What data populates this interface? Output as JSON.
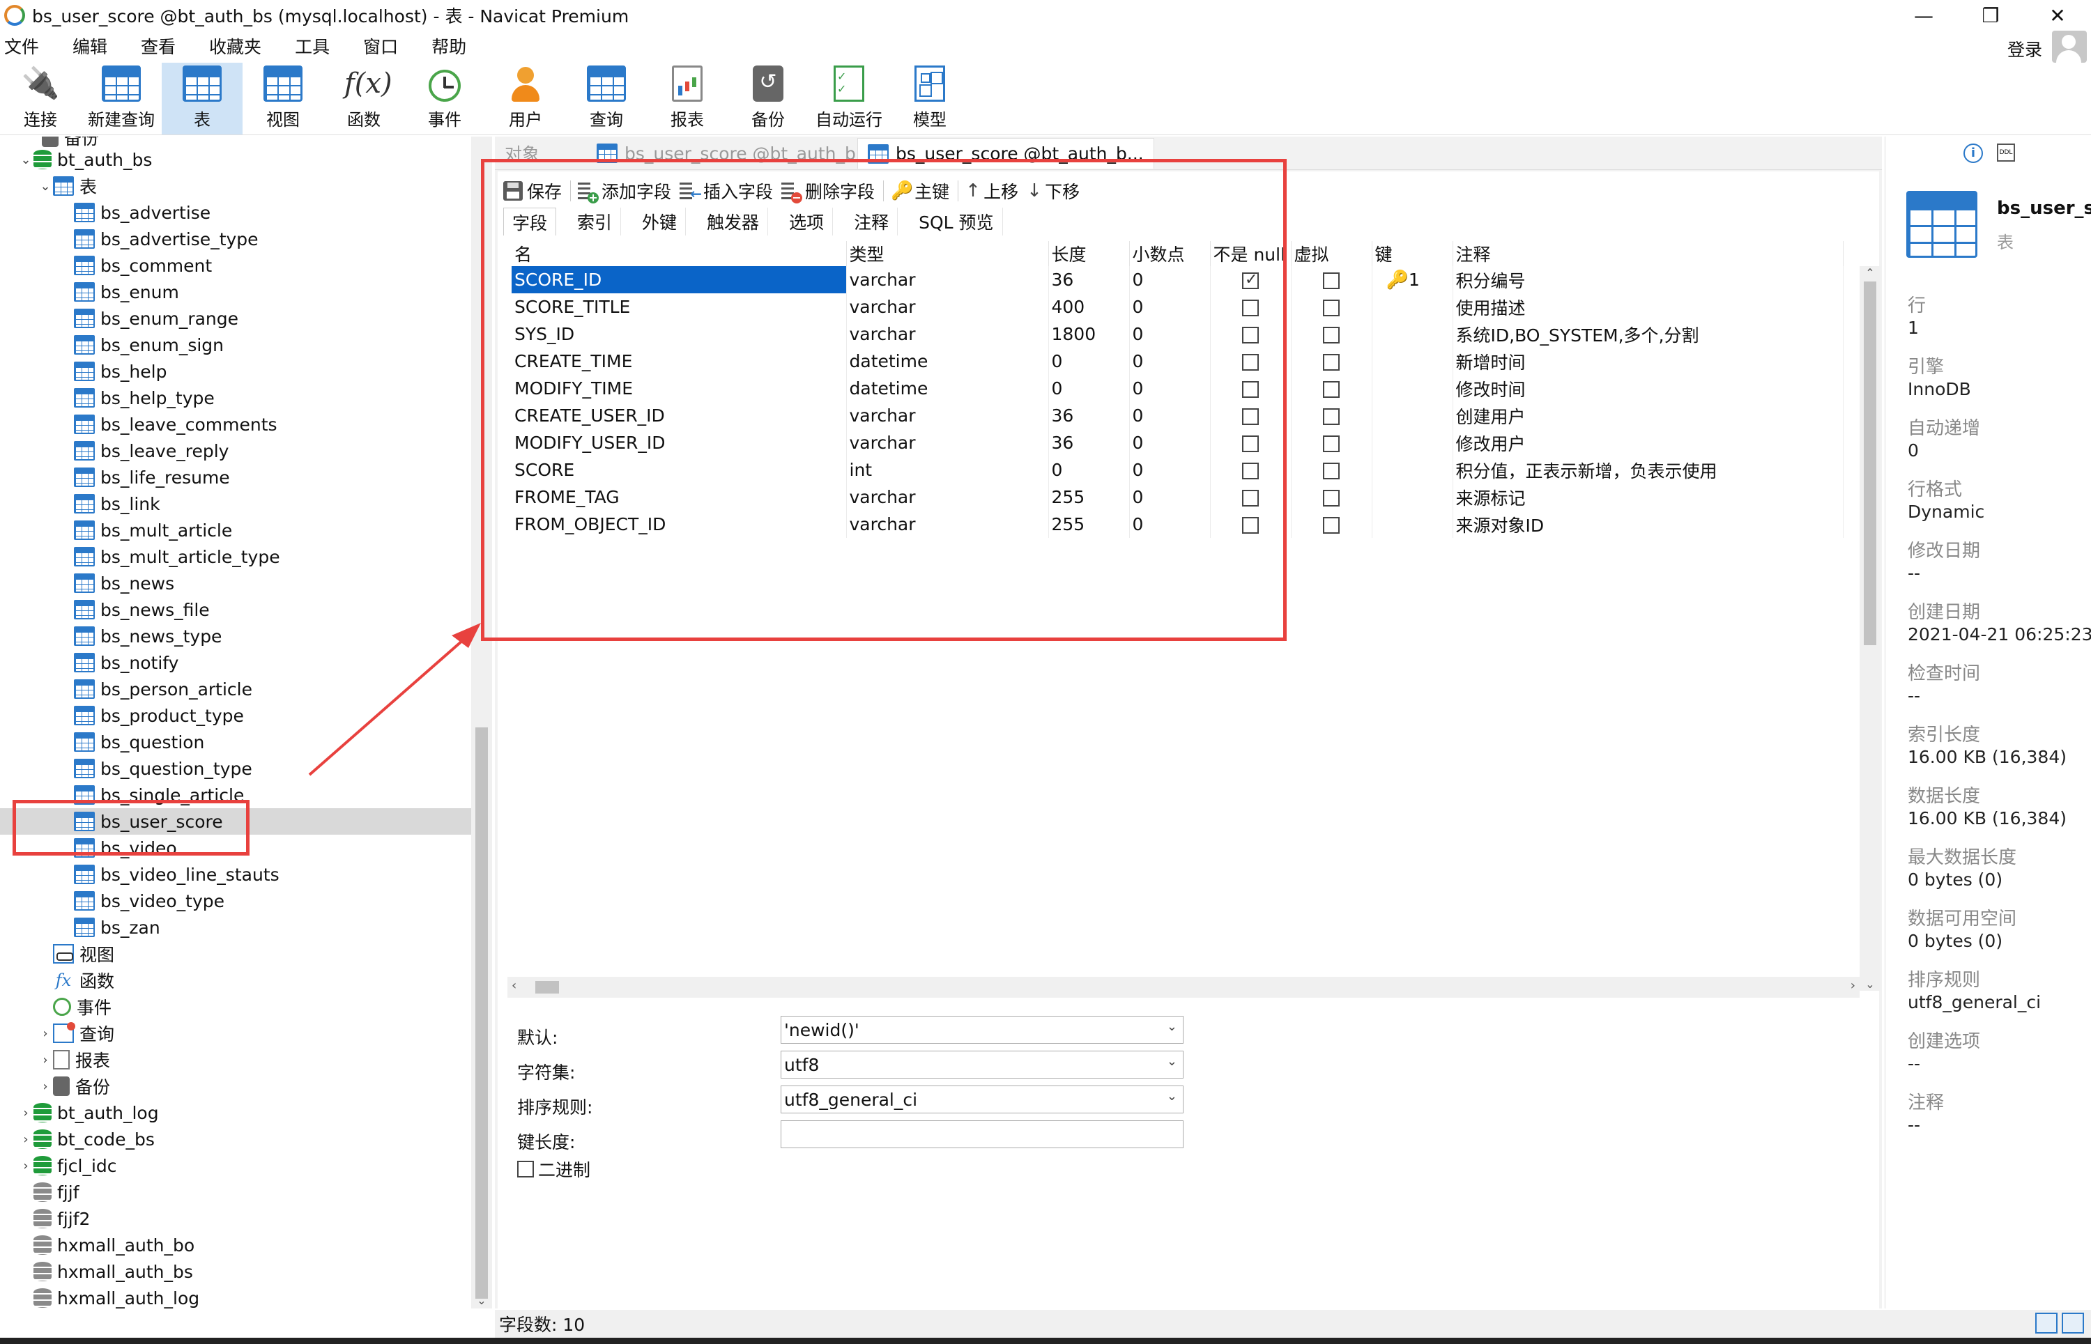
{
  "window": {
    "title": "bs_user_score @bt_auth_bs (mysql.localhost) - 表 - Navicat Premium",
    "controls": [
      "—",
      "❐",
      "✕"
    ]
  },
  "menu": [
    "文件",
    "编辑",
    "查看",
    "收藏夹",
    "工具",
    "窗口",
    "帮助"
  ],
  "login": "登录",
  "toolbar": [
    {
      "label": "连接",
      "icon": "plug-icon"
    },
    {
      "label": "新建查询",
      "icon": "new-query-icon"
    },
    {
      "label": "表",
      "icon": "table-icon",
      "active": true
    },
    {
      "label": "视图",
      "icon": "view-icon"
    },
    {
      "label": "函数",
      "icon": "function-icon"
    },
    {
      "label": "事件",
      "icon": "event-icon"
    },
    {
      "label": "用户",
      "icon": "user-icon"
    },
    {
      "label": "查询",
      "icon": "query-icon"
    },
    {
      "label": "报表",
      "icon": "report-icon"
    },
    {
      "label": "备份",
      "icon": "backup-icon"
    },
    {
      "label": "自动运行",
      "icon": "auto-run-icon"
    },
    {
      "label": "模型",
      "icon": "model-icon"
    }
  ],
  "tree": {
    "top_partial": "备份",
    "db": "bt_auth_bs",
    "tables_folder": "表",
    "tables": [
      "bs_advertise",
      "bs_advertise_type",
      "bs_comment",
      "bs_enum",
      "bs_enum_range",
      "bs_enum_sign",
      "bs_help",
      "bs_help_type",
      "bs_leave_comments",
      "bs_leave_reply",
      "bs_life_resume",
      "bs_link",
      "bs_mult_article",
      "bs_mult_article_type",
      "bs_news",
      "bs_news_file",
      "bs_news_type",
      "bs_notify",
      "bs_person_article",
      "bs_product_type",
      "bs_question",
      "bs_question_type",
      "bs_single_article",
      "bs_user_score",
      "bs_video",
      "bs_video_line_stauts",
      "bs_video_type",
      "bs_zan"
    ],
    "selected_table": "bs_user_score",
    "folders": [
      "视图",
      "函数",
      "事件",
      "查询",
      "报表",
      "备份"
    ],
    "other_dbs": [
      {
        "name": "bt_auth_log",
        "open": true
      },
      {
        "name": "bt_code_bs",
        "open": true
      },
      {
        "name": "fjcl_idc",
        "open": true
      },
      {
        "name": "fjjf",
        "open": false
      },
      {
        "name": "fjjf2",
        "open": false
      },
      {
        "name": "hxmall_auth_bo",
        "open": false
      },
      {
        "name": "hxmall_auth_bs",
        "open": false
      },
      {
        "name": "hxmall_auth_log",
        "open": false
      }
    ]
  },
  "doc_tabs": {
    "objects": "对象",
    "tab1": "bs_user_score @bt_auth_b...",
    "tab2": "bs_user_score @bt_auth_b..."
  },
  "design_toolbar": {
    "save": "保存",
    "add_field": "添加字段",
    "insert_field": "插入字段",
    "delete_field": "删除字段",
    "primary_key": "主键",
    "move_up": "上移",
    "move_down": "下移"
  },
  "sub_tabs": [
    "字段",
    "索引",
    "外键",
    "触发器",
    "选项",
    "注释",
    "SQL 预览"
  ],
  "columns": [
    "名",
    "类型",
    "长度",
    "小数点",
    "不是 null",
    "虚拟",
    "键",
    "注释"
  ],
  "fields": [
    {
      "name": "SCORE_ID",
      "type": "varchar",
      "length": "36",
      "decimals": "0",
      "not_null": true,
      "virtual": false,
      "key": "1",
      "comment": "积分编号"
    },
    {
      "name": "SCORE_TITLE",
      "type": "varchar",
      "length": "400",
      "decimals": "0",
      "not_null": false,
      "virtual": false,
      "key": "",
      "comment": "使用描述"
    },
    {
      "name": "SYS_ID",
      "type": "varchar",
      "length": "1800",
      "decimals": "0",
      "not_null": false,
      "virtual": false,
      "key": "",
      "comment": "系统ID,BO_SYSTEM,多个,分割"
    },
    {
      "name": "CREATE_TIME",
      "type": "datetime",
      "length": "0",
      "decimals": "0",
      "not_null": false,
      "virtual": false,
      "key": "",
      "comment": "新增时间"
    },
    {
      "name": "MODIFY_TIME",
      "type": "datetime",
      "length": "0",
      "decimals": "0",
      "not_null": false,
      "virtual": false,
      "key": "",
      "comment": "修改时间"
    },
    {
      "name": "CREATE_USER_ID",
      "type": "varchar",
      "length": "36",
      "decimals": "0",
      "not_null": false,
      "virtual": false,
      "key": "",
      "comment": "创建用户"
    },
    {
      "name": "MODIFY_USER_ID",
      "type": "varchar",
      "length": "36",
      "decimals": "0",
      "not_null": false,
      "virtual": false,
      "key": "",
      "comment": "修改用户"
    },
    {
      "name": "SCORE",
      "type": "int",
      "length": "0",
      "decimals": "0",
      "not_null": false,
      "virtual": false,
      "key": "",
      "comment": "积分值，正表示新增，负表示使用"
    },
    {
      "name": "FROME_TAG",
      "type": "varchar",
      "length": "255",
      "decimals": "0",
      "not_null": false,
      "virtual": false,
      "key": "",
      "comment": "来源标记"
    },
    {
      "name": "FROM_OBJECT_ID",
      "type": "varchar",
      "length": "255",
      "decimals": "0",
      "not_null": false,
      "virtual": false,
      "key": "",
      "comment": "来源对象ID"
    }
  ],
  "field_props": {
    "default_label": "默认:",
    "default_value": "'newid()'",
    "charset_label": "字符集:",
    "charset_value": "utf8",
    "collation_label": "排序规则:",
    "collation_value": "utf8_general_ci",
    "key_length_label": "键长度:",
    "key_length_value": "",
    "binary_label": "二进制"
  },
  "status": "字段数: 10",
  "info": {
    "name": "bs_user_s...",
    "kind": "表",
    "items": [
      {
        "label": "行",
        "value": "1"
      },
      {
        "label": "引擎",
        "value": "InnoDB"
      },
      {
        "label": "自动递增",
        "value": "0"
      },
      {
        "label": "行格式",
        "value": "Dynamic"
      },
      {
        "label": "修改日期",
        "value": "--"
      },
      {
        "label": "创建日期",
        "value": "2021-04-21 06:25:23"
      },
      {
        "label": "检查时间",
        "value": "--"
      },
      {
        "label": "索引长度",
        "value": "16.00 KB (16,384)"
      },
      {
        "label": "数据长度",
        "value": "16.00 KB (16,384)"
      },
      {
        "label": "最大数据长度",
        "value": "0 bytes (0)"
      },
      {
        "label": "数据可用空间",
        "value": "0 bytes (0)"
      },
      {
        "label": "排序规则",
        "value": "utf8_general_ci"
      },
      {
        "label": "创建选项",
        "value": "--"
      },
      {
        "label": "注释",
        "value": "--"
      }
    ]
  },
  "colors": {
    "accent": "#2b79c9",
    "selection": "#0a64c8",
    "annotation": "#e8413e",
    "db_icon": "#1f9b3a"
  }
}
